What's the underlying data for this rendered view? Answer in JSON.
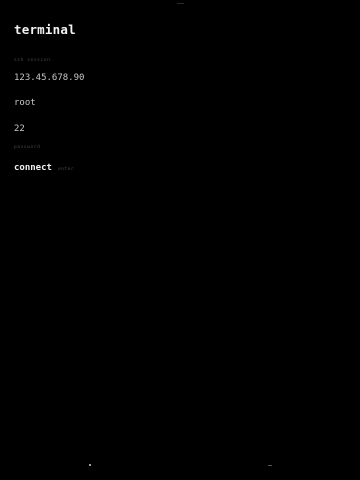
{
  "app": {
    "title": "terminal"
  },
  "server_section": {
    "label": "ssh session"
  },
  "fields": {
    "host": "123.45.678.90",
    "user": "root",
    "port": "22"
  },
  "auth_section": {
    "label": "password"
  },
  "actions": {
    "connect_label": "connect",
    "connect_hint": "enter"
  }
}
